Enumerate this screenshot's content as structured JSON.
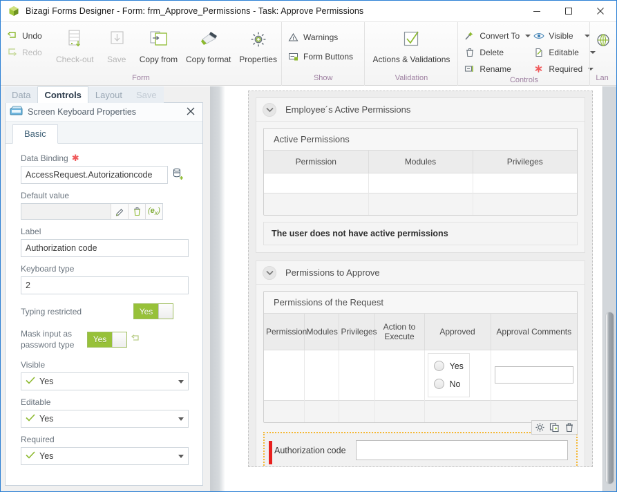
{
  "window": {
    "app_title": "Bizagi Forms Designer  - Form: frm_Approve_Permissions - Task:  Approve Permissions",
    "minimize_label": "Minimize",
    "maximize_label": "Maximize",
    "close_label": "Close",
    "logo_icon": "bizagi-cube-icon"
  },
  "ribbon": {
    "groups": [
      {
        "name": "form",
        "label": "Form",
        "small_buttons": [
          {
            "label": "Undo",
            "icon": "undo-arrow-icon",
            "disabled": false
          },
          {
            "label": "Redo",
            "icon": "redo-arrow-icon",
            "disabled": true
          }
        ],
        "big_buttons": [
          {
            "label": "Check-out",
            "icon": "checkout-icon",
            "disabled": true
          },
          {
            "label": "Save",
            "icon": "save-download-icon",
            "disabled": true
          },
          {
            "label": "Copy from",
            "icon": "copy-from-icon",
            "disabled": false
          },
          {
            "label": "Copy format",
            "icon": "paintbrush-icon",
            "disabled": false
          },
          {
            "label": "Properties",
            "icon": "gear-icon",
            "disabled": false
          }
        ]
      },
      {
        "name": "show",
        "label": "Show",
        "small_buttons": [
          {
            "label": "Warnings",
            "icon": "warning-triangle-icon",
            "disabled": false
          },
          {
            "label": "Form Buttons",
            "icon": "form-buttons-icon",
            "disabled": false
          }
        ]
      },
      {
        "name": "validation",
        "label": "Validation",
        "big_buttons": [
          {
            "label": "Actions & Validations",
            "icon": "checkmark-box-icon",
            "disabled": false
          }
        ]
      },
      {
        "name": "controls",
        "label": "Controls",
        "small_buttons": [
          {
            "label": "Convert To",
            "icon": "convert-wand-icon",
            "dropdown": true
          },
          {
            "label": "Delete",
            "icon": "trash-icon",
            "dropdown": false
          },
          {
            "label": "Rename",
            "icon": "rename-icon",
            "dropdown": false
          }
        ],
        "small_buttons_2": [
          {
            "label": "Visible",
            "icon": "eye-icon",
            "dropdown": true
          },
          {
            "label": "Editable",
            "icon": "editable-page-icon",
            "dropdown": true
          },
          {
            "label": "Required",
            "icon": "required-asterisk-icon",
            "dropdown": true
          }
        ]
      },
      {
        "name": "language",
        "label": "Lan",
        "big_buttons": [
          {
            "label": "",
            "icon": "globe-language-icon",
            "disabled": false
          }
        ]
      }
    ]
  },
  "left_panel": {
    "tabs": [
      {
        "label": "Data",
        "state": "inactive"
      },
      {
        "label": "Controls",
        "state": "active"
      },
      {
        "label": "Layout",
        "state": "inactive"
      },
      {
        "label": "Save",
        "state": "disabled"
      }
    ],
    "properties": {
      "header_title": "Screen Keyboard Properties",
      "header_icon": "screen-keyboard-icon",
      "close_icon": "close-icon",
      "inner_tab": "Basic",
      "fields": {
        "data_binding_label": "Data Binding",
        "data_binding_value": "AccessRequest.Autorizationcode",
        "data_binding_required": true,
        "data_binding_picker_icon": "database-add-icon",
        "default_value_label": "Default value",
        "default_value_value": "",
        "default_value_icons": [
          "pencil-icon",
          "trash-icon",
          "expression-ex-icon"
        ],
        "label_label": "Label",
        "label_value": "Authorization code",
        "keyboard_type_label": "Keyboard type",
        "keyboard_type_value": "2",
        "typing_restricted_label": "Typing restricted",
        "typing_restricted_value": "Yes",
        "mask_input_label": "Mask input as password type",
        "mask_input_value": "Yes",
        "mask_input_revert_icon": "undo-arrow-icon",
        "visible_label": "Visible",
        "visible_value": "Yes",
        "editable_label": "Editable",
        "editable_value": "Yes",
        "required_label": "Required",
        "required_value": "Yes"
      }
    }
  },
  "canvas": {
    "sections": [
      {
        "title": "Employee´s Active Permissions",
        "chevron_icon": "chevron-down-icon",
        "grid": {
          "title": "Active Permissions",
          "columns": [
            "Permission",
            "Modules",
            "Privileges"
          ]
        },
        "message": "The user does not have active permissions"
      },
      {
        "title": "Permissions to Approve",
        "chevron_icon": "chevron-down-icon",
        "grid": {
          "title": "Permissions of the Request",
          "columns": [
            "Permission",
            "Modules",
            "Privileges",
            "Action to Execute",
            "Approved",
            "Approval Comments"
          ],
          "radio_options": [
            "Yes",
            "No"
          ],
          "comment_value": ""
        }
      }
    ],
    "selected_control": {
      "label": "Authorization code",
      "value": "",
      "required_marker": true,
      "toolbar_icons": [
        "gear-icon",
        "duplicate-icon",
        "trash-icon"
      ],
      "selection_color": "#f5b731"
    },
    "scrollbar": {
      "orientation": "vertical"
    }
  },
  "colors": {
    "accent_blue": "#2a7fd4",
    "toggle_green": "#97c139",
    "group_label": "#9d7fa0",
    "required_red": "#e8201e",
    "selection_amber": "#f5b731"
  }
}
